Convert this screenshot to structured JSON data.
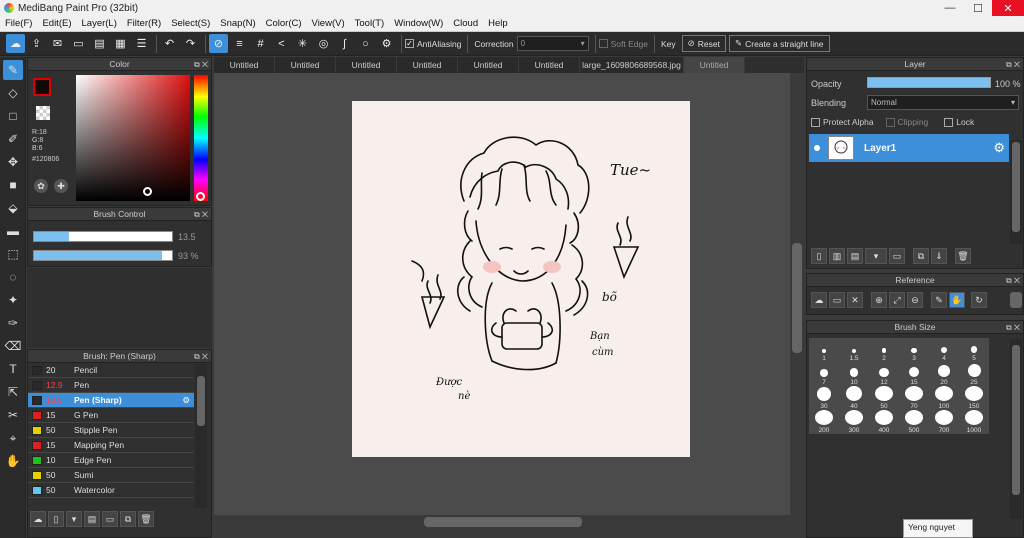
{
  "window": {
    "title": "MediBang Paint Pro (32bit)",
    "min": "—",
    "max": "☐",
    "close": "✕"
  },
  "menu": [
    "File(F)",
    "Edit(E)",
    "Layer(L)",
    "Filter(R)",
    "Select(S)",
    "Snap(N)",
    "Color(C)",
    "View(V)",
    "Tool(T)",
    "Window(W)",
    "Cloud",
    "Help"
  ],
  "toolbar": {
    "antialiasing_label": "AntiAliasing",
    "antialiasing_checked": true,
    "correction_label": "Correction",
    "correction_value": "0",
    "soft_edge_label": "Soft Edge",
    "key_label": "Key",
    "reset_label": "Reset",
    "straight_line_label": "Create a straight line"
  },
  "color_panel": {
    "title": "Color",
    "r": "R:18",
    "g": "G:8",
    "b": "B:6",
    "hex": "#120806",
    "main_color": "#120806",
    "accent": "#e00000"
  },
  "brush_control": {
    "title": "Brush Control",
    "size_value": "13.5",
    "size_fraction": 0.25,
    "opacity_value": "93 %",
    "opacity_fraction": 0.93
  },
  "brush_list": {
    "title": "Brush: Pen (Sharp)",
    "items": [
      {
        "size": "20",
        "name": "Pencil",
        "color": "#2a2a2a",
        "size_red": false,
        "selected": false
      },
      {
        "size": "12.9",
        "name": "Pen",
        "color": "#2a2a2a",
        "size_red": true,
        "selected": false
      },
      {
        "size": "13.5",
        "name": "Pen (Sharp)",
        "color": "#2a2a2a",
        "size_red": true,
        "selected": true
      },
      {
        "size": "15",
        "name": "G Pen",
        "color": "#e02020",
        "size_red": false,
        "selected": false
      },
      {
        "size": "50",
        "name": "Stipple Pen",
        "color": "#e8d000",
        "size_red": false,
        "selected": false
      },
      {
        "size": "15",
        "name": "Mapping Pen",
        "color": "#e02020",
        "size_red": false,
        "selected": false
      },
      {
        "size": "10",
        "name": "Edge Pen",
        "color": "#20c020",
        "size_red": false,
        "selected": false
      },
      {
        "size": "50",
        "name": "Sumi",
        "color": "#e8d000",
        "size_red": false,
        "selected": false
      },
      {
        "size": "50",
        "name": "Watercolor",
        "color": "#60c8f0",
        "size_red": false,
        "selected": false
      }
    ]
  },
  "tabs": [
    {
      "label": "Untitled",
      "active": false
    },
    {
      "label": "Untitled",
      "active": false
    },
    {
      "label": "Untitled",
      "active": false
    },
    {
      "label": "Untitled",
      "active": false
    },
    {
      "label": "Untitled",
      "active": false
    },
    {
      "label": "Untitled",
      "active": false
    },
    {
      "label": "large_1609806689568.jpg",
      "active": false
    },
    {
      "label": "Untitled",
      "active": true
    }
  ],
  "canvas": {
    "bg": "#f8efed",
    "texts": [
      "Tue~",
      "bõ",
      "Bạn",
      "cùm",
      "Được",
      "nè"
    ]
  },
  "layer_panel": {
    "title": "Layer",
    "opacity_label": "Opacity",
    "opacity_value": "100 %",
    "blending_label": "Blending",
    "blending_value": "Normal",
    "protect_alpha_label": "Protect Alpha",
    "clipping_label": "Clipping",
    "lock_label": "Lock",
    "layers": [
      {
        "name": "Layer1",
        "selected": true
      }
    ]
  },
  "reference_panel": {
    "title": "Reference"
  },
  "brush_size_panel": {
    "title": "Brush Size",
    "sizes": [
      "1",
      "1.5",
      "2",
      "3",
      "4",
      "5",
      "7",
      "10",
      "12",
      "15",
      "20",
      "25",
      "30",
      "40",
      "50",
      "70",
      "100",
      "150",
      "200",
      "300",
      "400",
      "500",
      "700",
      "1000"
    ]
  },
  "tooltip": {
    "text": "Yeng nguyet"
  }
}
